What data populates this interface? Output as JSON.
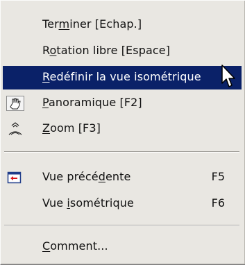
{
  "menu": {
    "items": [
      {
        "pre": "Ter",
        "u": "m",
        "post": "iner  [Echap.]"
      },
      {
        "pre": "R",
        "u": "o",
        "post": "tation libre   [Espace]"
      },
      {
        "pre": "",
        "u": "R",
        "post": "edéfinir la vue isométrique"
      },
      {
        "pre": "",
        "u": "P",
        "post": "anoramique  [F2]",
        "icon": "pan-hand-icon"
      },
      {
        "pre": "",
        "u": "Z",
        "post": "oom  [F3]",
        "icon": "zoom-icon"
      },
      {
        "pre": "Vue précé",
        "u": "d",
        "post": "ente",
        "shortcut": "F5",
        "icon": "previous-view-icon"
      },
      {
        "pre": "Vue ",
        "u": "i",
        "post": "sométrique",
        "shortcut": "F6"
      },
      {
        "pre": "",
        "u": "C",
        "post": "omment..."
      }
    ],
    "highlight_color": "#0a2168",
    "background_color": "#e9e7e2"
  }
}
